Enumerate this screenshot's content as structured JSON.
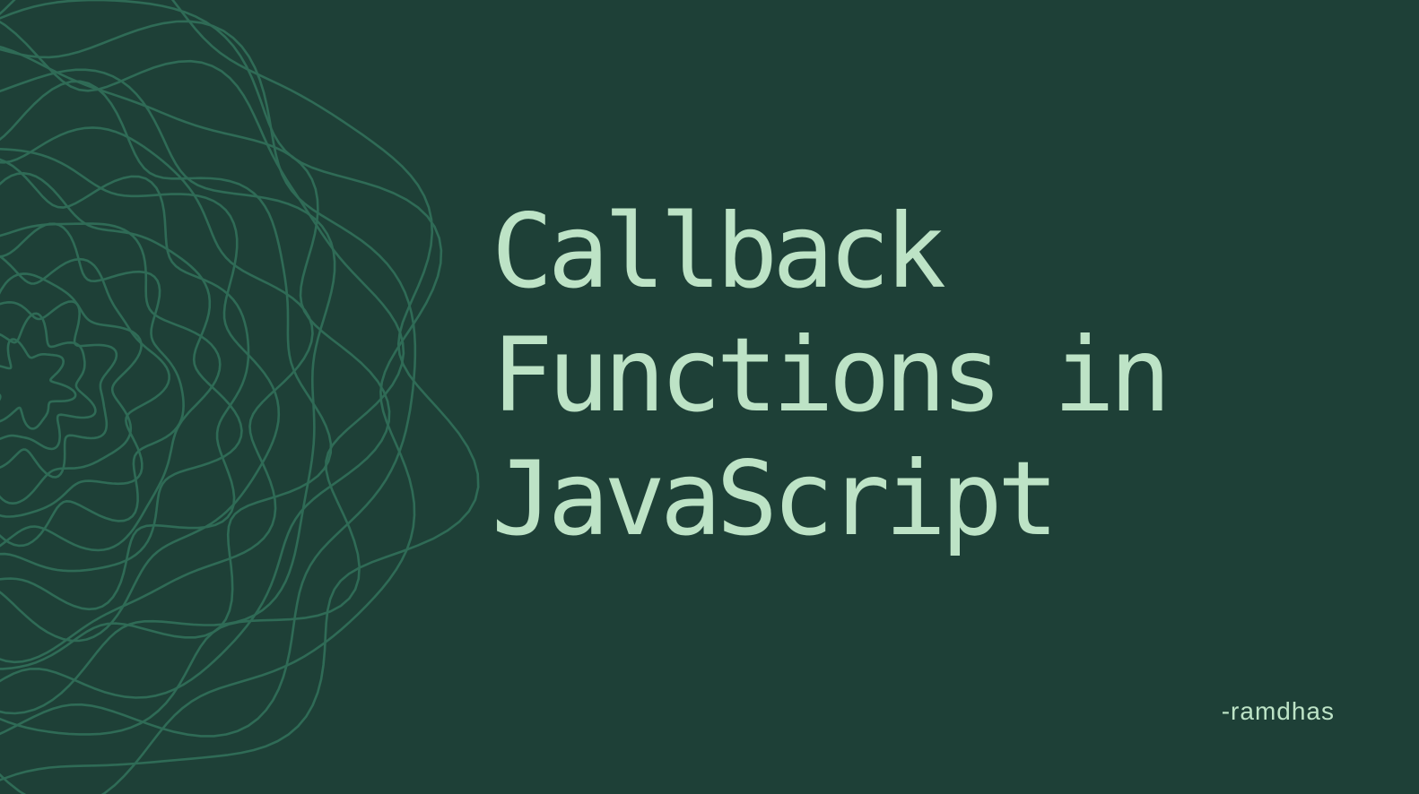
{
  "theme": {
    "background": "#1e4037",
    "title_color": "#bde3c6",
    "pattern_color": "#2f6b56",
    "author_color": "#bde3c6"
  },
  "title_lines": [
    "Callback",
    "Functions in",
    "JavaScript"
  ],
  "author": "-ramdhas"
}
